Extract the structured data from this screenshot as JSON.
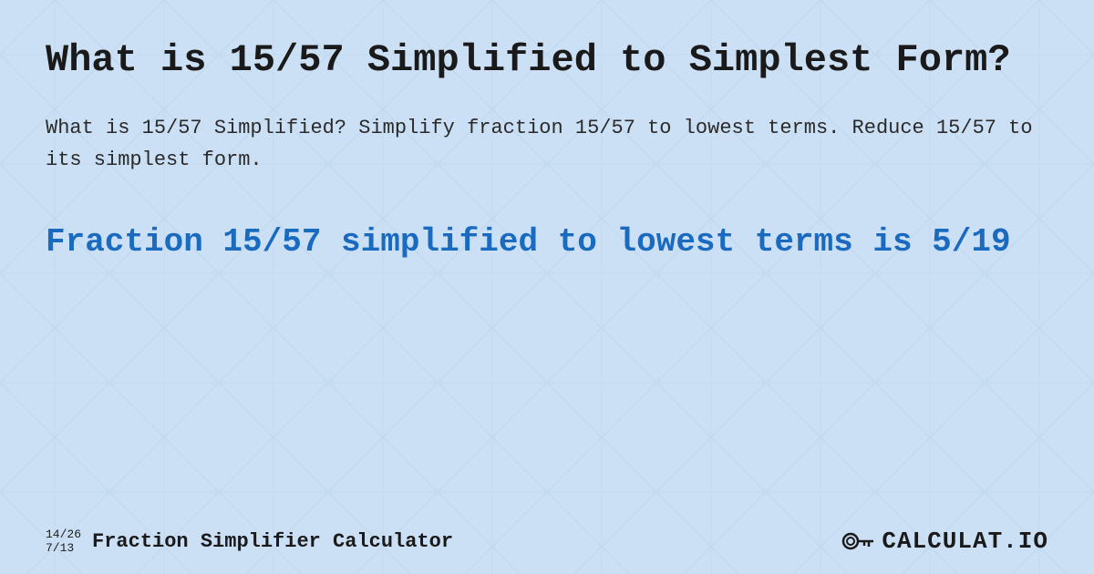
{
  "background": {
    "color": "#cce0f5"
  },
  "header": {
    "title": "What is 15/57 Simplified to Simplest Form?"
  },
  "description": {
    "text": "What is 15/57 Simplified? Simplify fraction 15/57 to lowest terms. Reduce 15/57 to its simplest form."
  },
  "result": {
    "title": "Fraction 15/57 simplified to lowest terms is 5/19"
  },
  "footer": {
    "fraction1": "14/26",
    "fraction2": "7/13",
    "brand_name": "Fraction Simplifier Calculator",
    "logo_text": "CALCULAT.IO"
  }
}
